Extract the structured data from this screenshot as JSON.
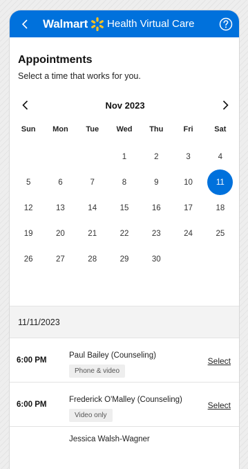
{
  "header": {
    "brand": "Walmart",
    "product": "Health Virtual Care",
    "back_icon": "chevron-left-icon",
    "help_icon": "help-circle-icon",
    "brand_color": "#0071dc"
  },
  "page": {
    "title": "Appointments",
    "subtitle": "Select a time that works for you."
  },
  "calendar": {
    "month_label": "Nov 2023",
    "weekdays": [
      "Sun",
      "Mon",
      "Tue",
      "Wed",
      "Thu",
      "Fri",
      "Sat"
    ],
    "first_weekday_index": 3,
    "days": [
      "1",
      "2",
      "3",
      "4",
      "5",
      "6",
      "7",
      "8",
      "9",
      "10",
      "11",
      "12",
      "13",
      "14",
      "15",
      "16",
      "17",
      "18",
      "19",
      "20",
      "21",
      "22",
      "23",
      "24",
      "25",
      "26",
      "27",
      "28",
      "29",
      "30"
    ],
    "selected_day": "11",
    "selected_color": "#0071dc"
  },
  "selected_date": "11/11/2023",
  "slots": [
    {
      "time": "6:00 PM",
      "provider": "Paul Bailey (Counseling)",
      "mode": "Phone & video",
      "action": "Select"
    },
    {
      "time": "6:00 PM",
      "provider": "Frederick O'Malley (Counseling)",
      "mode": "Video only",
      "action": "Select"
    },
    {
      "time": "",
      "provider": "Jessica Walsh-Wagner",
      "mode": "",
      "action": ""
    }
  ]
}
